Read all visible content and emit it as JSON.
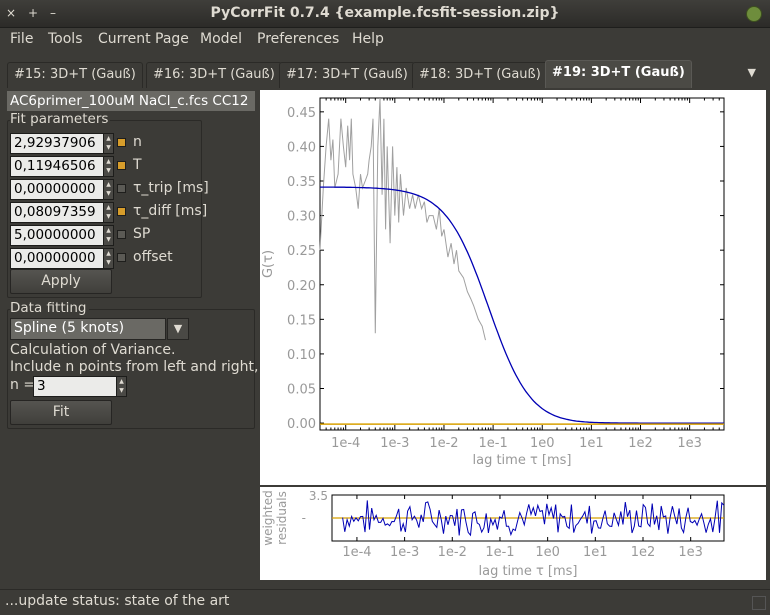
{
  "window": {
    "title": "PyCorrFit 0.7.4 {example.fcsfit-session.zip}",
    "close_glyph": "×",
    "max_glyph": "+",
    "min_glyph": "–"
  },
  "menu": [
    "File",
    "Tools",
    "Current Page",
    "Model",
    "Preferences",
    "Help"
  ],
  "tabs": [
    "#15: 3D+T (Gauß)",
    "#16: 3D+T (Gauß)",
    "#17: 3D+T (Gauß)",
    "#18: 3D+T (Gauß)",
    "#19: 3D+T (Gauß)"
  ],
  "active_tab": 4,
  "tab_menu_glyph": "▼",
  "page": {
    "filename": "AC6primer_100uM NaCl_c.fcs CC12",
    "fit_parameters_label": "Fit parameters",
    "params": [
      {
        "value": "2,92937906",
        "checked": true,
        "label": "n"
      },
      {
        "value": "0,11946506",
        "checked": true,
        "label": "T"
      },
      {
        "value": "0,00000000",
        "checked": false,
        "label": "τ_trip [ms]"
      },
      {
        "value": "0,08097359",
        "checked": true,
        "label": "τ_diff [ms]"
      },
      {
        "value": "5,00000000",
        "checked": false,
        "label": "SP"
      },
      {
        "value": "0,00000000",
        "checked": false,
        "label": "offset"
      }
    ],
    "apply_label": "Apply",
    "data_fitting_label": "Data fitting",
    "algorithm": "Spline (5 knots)",
    "variance_line1": "Calculation of Variance.",
    "variance_line2": "Include n points from left and right,",
    "n_label": "n =",
    "n_value": "3",
    "fit_label": "Fit"
  },
  "colors": {
    "data": "#a0a0a0",
    "fit": "#0000b4",
    "weights": "#d8a000"
  },
  "chart_data": [
    {
      "type": "line",
      "xlabel": "lag time τ [ms]",
      "ylabel": "G(τ)",
      "xscale": "log",
      "xlim": [
        3e-05,
        5000
      ],
      "ylim": [
        -0.01,
        0.47
      ],
      "xticks": [
        "1e-4",
        "1e-3",
        "1e-2",
        "1e-1",
        "1e0",
        "1e1",
        "1e2",
        "1e3"
      ],
      "yticks": [
        "0.00",
        "0.05",
        "0.10",
        "0.15",
        "0.20",
        "0.25",
        "0.30",
        "0.35",
        "0.40",
        "0.45"
      ],
      "fit_params": {
        "n": 2.92937906,
        "T": 0.11946506,
        "tau_diff": 0.08097359,
        "SP": 5.0,
        "offset": 0.0
      },
      "data_x": [
        3e-05,
        3.5e-05,
        4e-05,
        4.5e-05,
        5e-05,
        5.5e-05,
        6e-05,
        7e-05,
        8e-05,
        9e-05,
        0.0001,
        0.00011,
        0.00012,
        0.00013,
        0.00014,
        0.00016,
        0.00018,
        0.0002,
        0.00022,
        0.00025,
        0.00028,
        0.0003,
        0.00033,
        0.00036,
        0.0004,
        0.00045,
        0.0005,
        0.00055,
        0.0006,
        0.00065,
        0.0007,
        0.0008,
        0.0009,
        0.001,
        0.0011,
        0.0012,
        0.0013,
        0.0015,
        0.0017,
        0.002,
        0.0023,
        0.0026,
        0.003,
        0.0035,
        0.004,
        0.0045,
        0.005,
        0.006,
        0.007,
        0.008,
        0.009,
        0.01,
        0.012,
        0.014,
        0.016,
        0.018,
        0.02,
        0.025,
        0.03,
        0.035,
        0.04,
        0.05,
        0.06,
        0.07
      ],
      "data_y": [
        0.25,
        0.34,
        0.4,
        0.44,
        0.38,
        0.41,
        0.34,
        0.36,
        0.44,
        0.4,
        0.37,
        0.43,
        0.38,
        0.44,
        0.36,
        0.34,
        0.31,
        0.36,
        0.34,
        0.35,
        0.36,
        0.38,
        0.4,
        0.44,
        0.13,
        0.4,
        0.47,
        0.33,
        0.44,
        0.28,
        0.4,
        0.26,
        0.4,
        0.3,
        0.37,
        0.29,
        0.36,
        0.3,
        0.34,
        0.31,
        0.33,
        0.31,
        0.33,
        0.31,
        0.32,
        0.29,
        0.3,
        0.3,
        0.28,
        0.31,
        0.27,
        0.28,
        0.24,
        0.26,
        0.23,
        0.25,
        0.22,
        0.21,
        0.19,
        0.18,
        0.17,
        0.15,
        0.14,
        0.12
      ]
    },
    {
      "type": "line",
      "xlabel": "lag time τ [ms]",
      "ylabel": "weighted residuals",
      "xscale": "log",
      "xlim": [
        3e-05,
        5000
      ],
      "ylim": [
        -3.5,
        3.5
      ],
      "ytick_top": "3.5",
      "ytick_mid": "-",
      "xticks": [
        "1e-4",
        "1e-3",
        "1e-2",
        "1e-1",
        "1e0",
        "1e1",
        "1e2",
        "1e3"
      ],
      "seed": 7
    }
  ],
  "status": "...update status: state of the art"
}
